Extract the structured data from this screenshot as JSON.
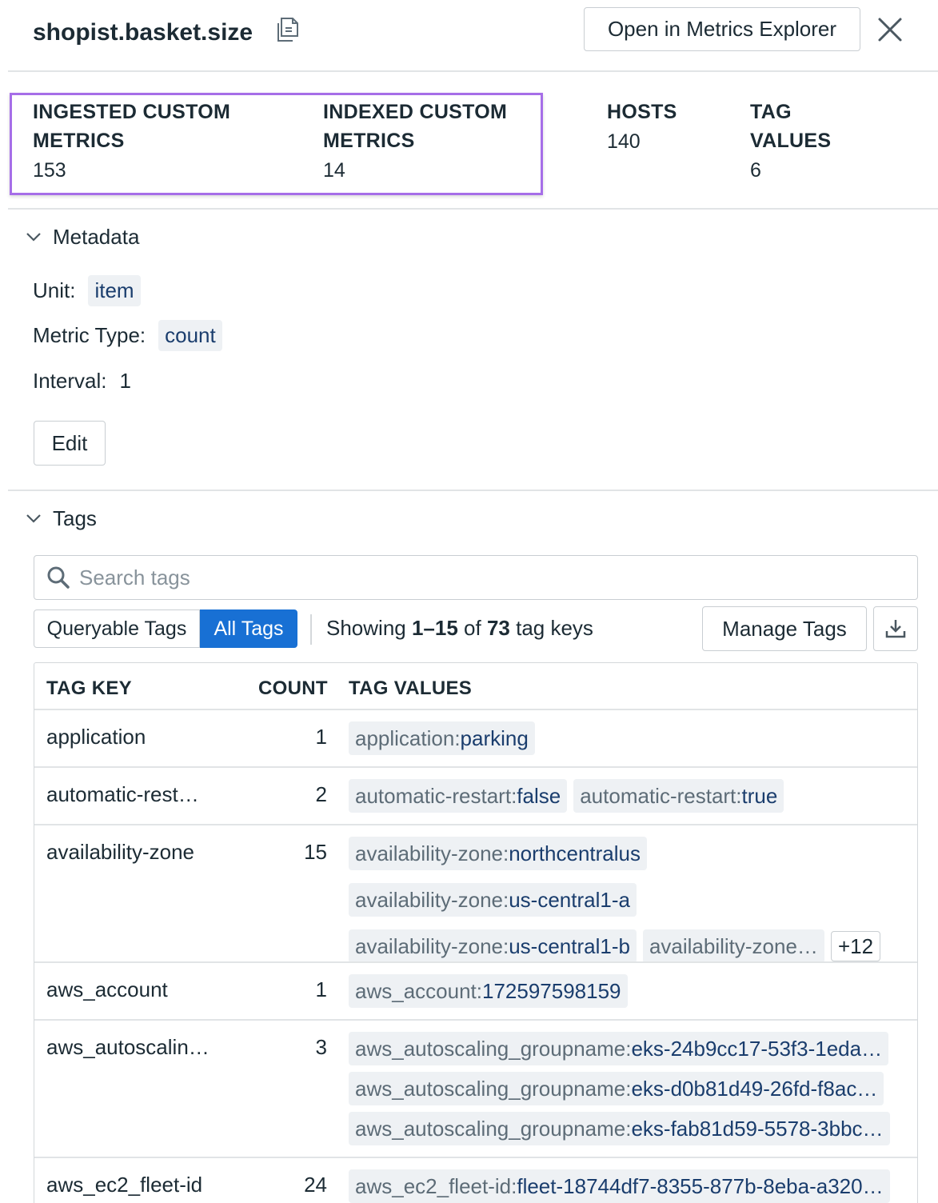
{
  "header": {
    "metric_name": "shopist.basket.size",
    "open_button": "Open in Metrics Explorer"
  },
  "stats": {
    "ingested_label_1": "INGESTED CUSTOM",
    "ingested_label_2": "METRICS",
    "ingested_value": "153",
    "indexed_label_1": "INDEXED CUSTOM",
    "indexed_label_2": "METRICS",
    "indexed_value": "14",
    "hosts_label": "HOSTS",
    "hosts_value": "140",
    "tagvalues_label_1": "TAG",
    "tagvalues_label_2": "VALUES",
    "tagvalues_value": "6",
    "highlight_color": "#a66ee8"
  },
  "metadata": {
    "title": "Metadata",
    "unit_label": "Unit:",
    "unit_value": "item",
    "type_label": "Metric Type:",
    "type_value": "count",
    "interval_label": "Interval:",
    "interval_value": "1",
    "edit_button": "Edit"
  },
  "tags": {
    "title": "Tags",
    "search_placeholder": "Search tags",
    "queryable_tab": "Queryable Tags",
    "all_tab": "All Tags",
    "showing_prefix": "Showing ",
    "showing_range": "1–15",
    "showing_of": " of ",
    "showing_total": "73",
    "showing_suffix": " tag keys",
    "manage_button": "Manage Tags",
    "accent_color": "#1870d4",
    "columns": [
      "TAG KEY",
      "COUNT",
      "TAG VALUES"
    ],
    "rows": [
      {
        "key": "application",
        "count": "1",
        "values": [
          {
            "k": "application:",
            "v": "parking"
          }
        ]
      },
      {
        "key": "automatic-rest…",
        "count": "2",
        "values": [
          {
            "k": "automatic-restart:",
            "v": "false"
          },
          {
            "k": "automatic-restart:",
            "v": "true"
          }
        ]
      },
      {
        "key": "availability-zone",
        "count": "15",
        "values": [
          {
            "k": "availability-zone:",
            "v": "northcentralus"
          },
          {
            "k": "availability-zone:",
            "v": "us-central1-a"
          },
          {
            "k": "availability-zone:",
            "v": "us-central1-b"
          },
          {
            "k": "availability-zone…",
            "v": ""
          }
        ],
        "more": "+12"
      },
      {
        "key": "aws_account",
        "count": "1",
        "values": [
          {
            "k": "aws_account:",
            "v": "172597598159"
          }
        ]
      },
      {
        "key": "aws_autoscalin…",
        "count": "3",
        "values": [
          {
            "k": "aws_autoscaling_groupname:",
            "v": "eks-24b9cc17-53f3-1eda…"
          },
          {
            "k": "aws_autoscaling_groupname:",
            "v": "eks-d0b81d49-26fd-f8ac…"
          },
          {
            "k": "aws_autoscaling_groupname:",
            "v": "eks-fab81d59-5578-3bbc…"
          }
        ]
      },
      {
        "key": "aws_ec2_fleet-id",
        "count": "24",
        "values": [
          {
            "k": "aws_ec2_fleet-id:",
            "v": "fleet-18744df7-8355-877b-8eba-a320…"
          }
        ]
      }
    ]
  }
}
